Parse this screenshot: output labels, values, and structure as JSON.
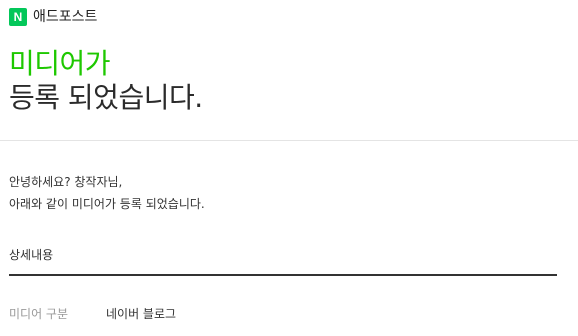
{
  "brand": {
    "logo_letter": "N",
    "name": "애드포스트",
    "accent_color": "#03c75a"
  },
  "headline": {
    "line1": "미디어가",
    "line2": "등록 되었습니다.",
    "line1_color": "#1ec800"
  },
  "message": {
    "greeting": "안녕하세요? 창작자님,",
    "body": "아래와 같이 미디어가 등록 되었습니다."
  },
  "details": {
    "title": "상세내용",
    "rows": [
      {
        "label": "미디어 구분",
        "value": "네이버 블로그"
      }
    ]
  }
}
